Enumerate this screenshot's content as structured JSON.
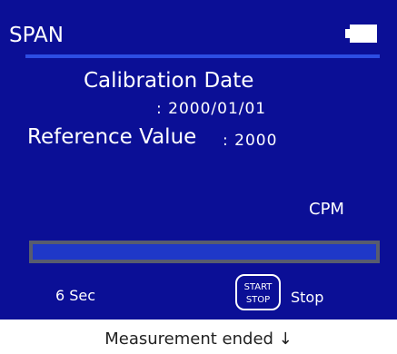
{
  "header": {
    "title": "SPAN",
    "battery_icon": "battery-icon"
  },
  "calibration": {
    "label": "Calibration Date",
    "value": ": 2000/01/01"
  },
  "reference": {
    "label": "Reference Value",
    "value": ": 2000"
  },
  "measurement": {
    "unit": "CPM",
    "time": "6 Sec",
    "progress_bar_color": "#1f38c8"
  },
  "buttons": {
    "start_label": "START",
    "stop_label": "STOP"
  },
  "status": {
    "text": "Stop"
  },
  "caption": {
    "text": "Measurement ended ↓"
  },
  "colors": {
    "screen_background": "#0b0f96",
    "accent_line": "#2d4de3",
    "bar_frame": "#575c6f"
  }
}
